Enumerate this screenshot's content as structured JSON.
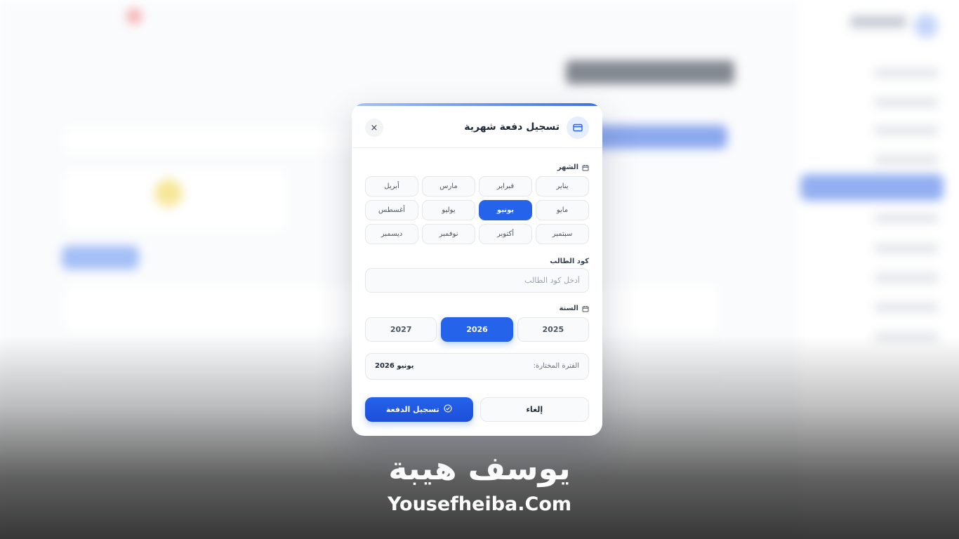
{
  "modal": {
    "title": "تسجيل دفعة شهرية",
    "close_label": "×",
    "month_section": {
      "label": "الشهر",
      "months": [
        "يناير",
        "فبراير",
        "مارس",
        "أبريل",
        "مايو",
        "يونيو",
        "يوليو",
        "أغسطس",
        "سبتمبر",
        "أكتوبر",
        "نوفمبر",
        "ديسمبر"
      ],
      "selected": "يونيو"
    },
    "student_code": {
      "label": "كود الطالب",
      "placeholder": "أدخل كود الطالب",
      "value": ""
    },
    "year_section": {
      "label": "السنة",
      "years": [
        "2025",
        "2026",
        "2027"
      ],
      "selected": "2026"
    },
    "selected_period": {
      "label": "الفترة المختارة:",
      "value": "يونيو 2026"
    },
    "actions": {
      "cancel": "إلغاء",
      "submit": "تسجيل الدفعة"
    }
  },
  "watermark": {
    "arabic": "يوسف هيبة",
    "english": "Yousefheiba.Com"
  },
  "colors": {
    "accent": "#2563eb",
    "accent_dark": "#1d4ed8"
  },
  "icons": {
    "header": "credit-card-icon",
    "section": "calendar-icon",
    "submit": "check-circle-icon"
  }
}
